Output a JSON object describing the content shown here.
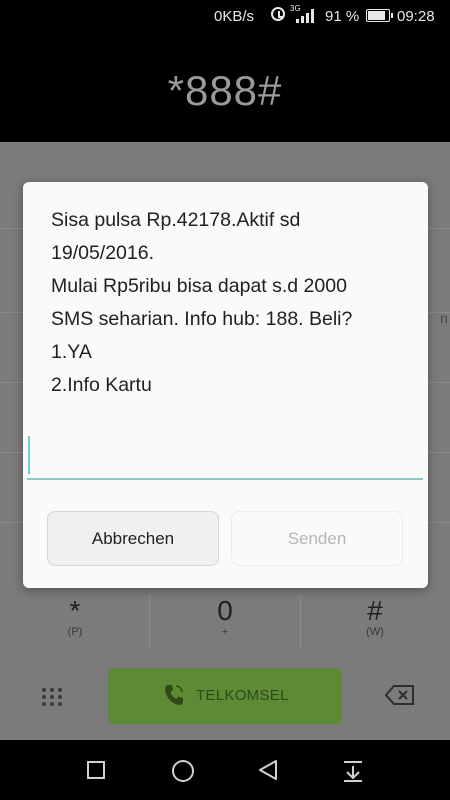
{
  "status_bar": {
    "network_speed": "0KB/s",
    "network_type": "3G",
    "battery_percent": "91 %",
    "battery_level": 0.91,
    "time": "09:28"
  },
  "dialer": {
    "dialed_number": "*888#",
    "keys": [
      {
        "main": "*",
        "sub": "(P)"
      },
      {
        "main": "0",
        "sub": "+"
      },
      {
        "main": "#",
        "sub": "(W)"
      }
    ],
    "call_button_label": "TELKOMSEL",
    "background_fragment": "n"
  },
  "ussd_dialog": {
    "message": "Sisa pulsa Rp.42178.Aktif sd\n19/05/2016.\nMulai Rp5ribu bisa dapat s.d 2000\nSMS seharian. Info hub: 188. Beli?\n1.YA\n2.Info Kartu",
    "input_value": "",
    "cancel_label": "Abbrechen",
    "send_label": "Senden"
  },
  "icons": {
    "alarm": "alarm-icon",
    "signal": "signal-icon",
    "battery": "battery-icon",
    "phone": "phone-icon",
    "dialpad": "dialpad-grid-icon",
    "delete": "backspace-icon",
    "recents": "recents-square-icon",
    "home": "home-circle-icon",
    "back": "back-triangle-icon",
    "notifications": "pull-down-icon"
  },
  "colors": {
    "call_button": "#5e8a36",
    "input_underline": "#7fd0c8",
    "backdrop": "#7b7b7b"
  }
}
